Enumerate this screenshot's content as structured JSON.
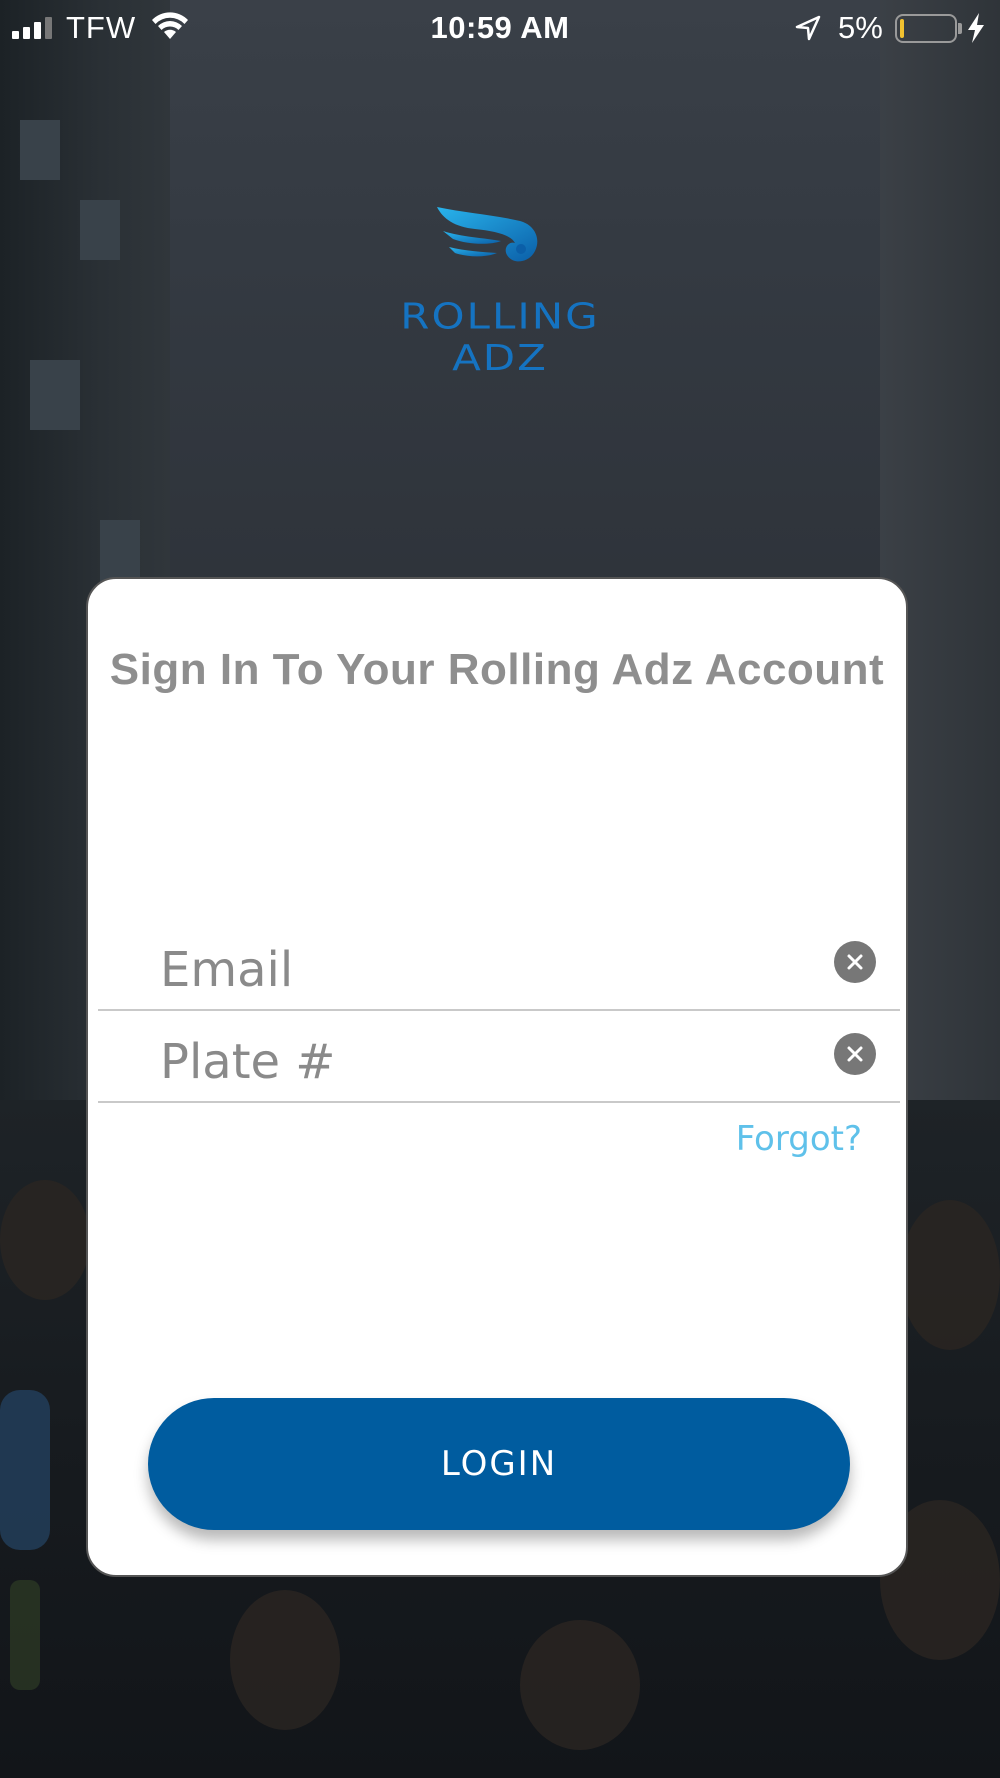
{
  "status_bar": {
    "carrier": "TFW",
    "time": "10:59 AM",
    "battery_percent": "5%",
    "battery_level": 0.05,
    "icons": [
      "signal-icon",
      "wifi-icon",
      "location-arrow-icon",
      "battery-icon",
      "charging-bolt-icon"
    ]
  },
  "logo": {
    "text": "ROLLING ADZ",
    "mark_icon": "wings-logo-icon",
    "color": "#1573c1"
  },
  "login_card": {
    "title": "Sign In To Your Rolling Adz Account",
    "email": {
      "value": "",
      "placeholder": "Email",
      "clear_icon": "clear-circle-icon"
    },
    "plate": {
      "value": "",
      "placeholder": "Plate #",
      "clear_icon": "clear-circle-icon"
    },
    "forgot_label": "Forgot?",
    "login_label": "LOGIN"
  },
  "colors": {
    "primary_button": "#005c9f",
    "link": "#5fc1ea",
    "title_text": "#8e8e8e",
    "battery_low": "#f2c230"
  }
}
